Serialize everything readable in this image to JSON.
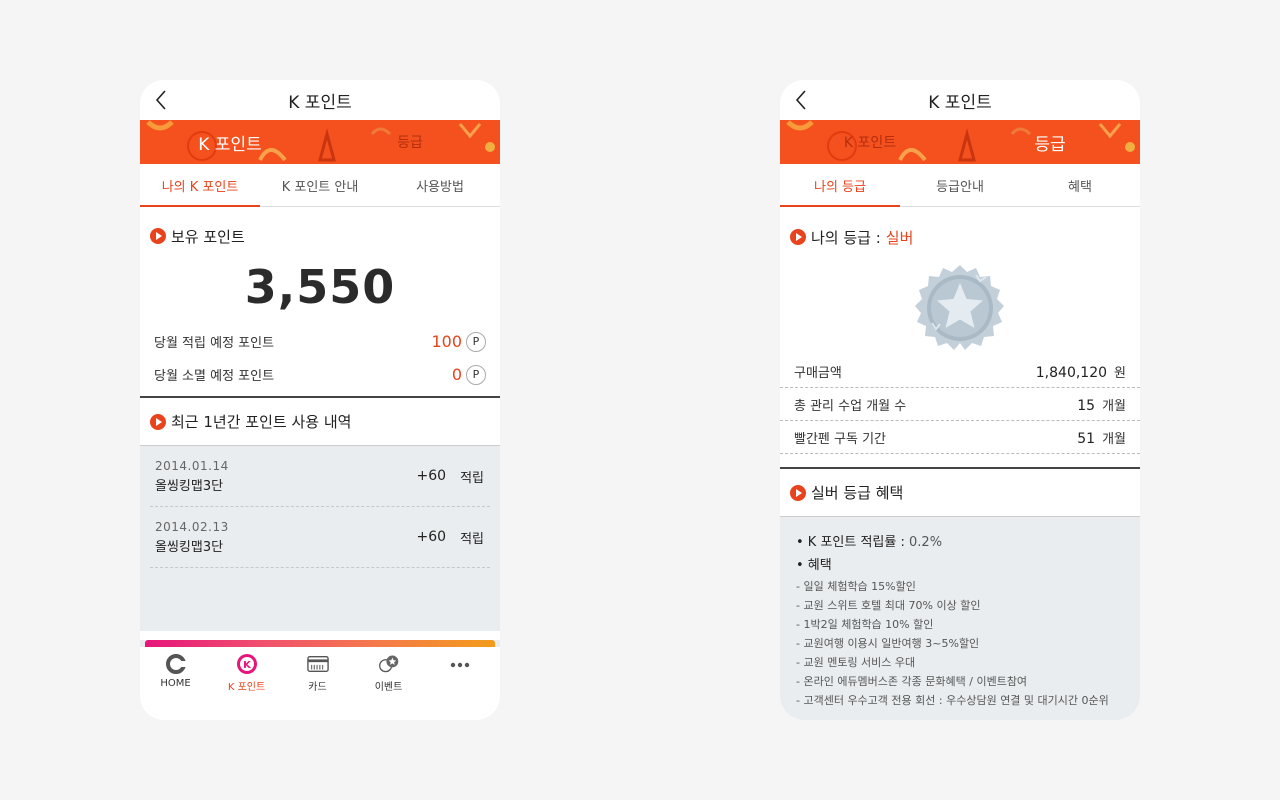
{
  "left": {
    "title": "K 포인트",
    "banner_tabs": [
      "K 포인트",
      "등급"
    ],
    "sub_tabs": [
      "나의 K 포인트",
      "K 포인트 안내",
      "사용방법"
    ],
    "held_label": "보유 포인트",
    "points": "3,550",
    "monthly": [
      {
        "label": "당월 적립 예정 포인트",
        "value": "100",
        "badge": "P"
      },
      {
        "label": "당월 소멸 예정 포인트",
        "value": "0",
        "badge": "P"
      }
    ],
    "history_label": "최근 1년간 포인트 사용 내역",
    "history": [
      {
        "date": "2014.01.14",
        "name": "올씽킹맵3단",
        "amount": "+60",
        "type": "적립"
      },
      {
        "date": "2014.02.13",
        "name": "올씽킹맵3단",
        "amount": "+60",
        "type": "적립"
      }
    ],
    "nav": [
      {
        "label": "HOME",
        "icon": "home-icon"
      },
      {
        "label": "K 포인트",
        "icon": "k-point-icon",
        "active": true
      },
      {
        "label": "카드",
        "icon": "card-icon"
      },
      {
        "label": "이벤트",
        "icon": "event-icon"
      },
      {
        "label": "",
        "icon": "more-icon"
      }
    ]
  },
  "right": {
    "title": "K 포인트",
    "banner_tabs": [
      "K 포인트",
      "등급"
    ],
    "sub_tabs": [
      "나의 등급",
      "등급안내",
      "혜택"
    ],
    "grade_label": "나의 등급 :",
    "grade_value": "실버",
    "info": [
      {
        "label": "구매금액",
        "value": "1,840,120",
        "unit": "원"
      },
      {
        "label": "총 관리 수업 개월 수",
        "value": "15",
        "unit": "개월"
      },
      {
        "label": "빨간펜 구독 기간",
        "value": "51",
        "unit": "개월"
      }
    ],
    "benefit_label": "실버 등급 혜택",
    "rate_label": "• K 포인트 적립률 :",
    "rate_value": "0.2%",
    "benefit_title": "• 혜택",
    "benefits": [
      "- 일일 체험학습 15%할인",
      "- 교원 스위트 호텔 최대 70% 이상 할인",
      "- 1박2일 체험학습 10% 할인",
      "- 교원여행 이용시 일반여행 3~5%할인",
      "- 교원 멘토링 서비스 우대",
      "- 온라인 에듀멤버스존 각종 문화혜택 / 이벤트참여",
      "- 고객센터 우수고객 전용 회선 : 우수상담원 연결 및 대기시간 0순위"
    ]
  },
  "colors": {
    "accent": "#e8431c",
    "banner": "#f4511e",
    "panel": "#eaedf0"
  }
}
